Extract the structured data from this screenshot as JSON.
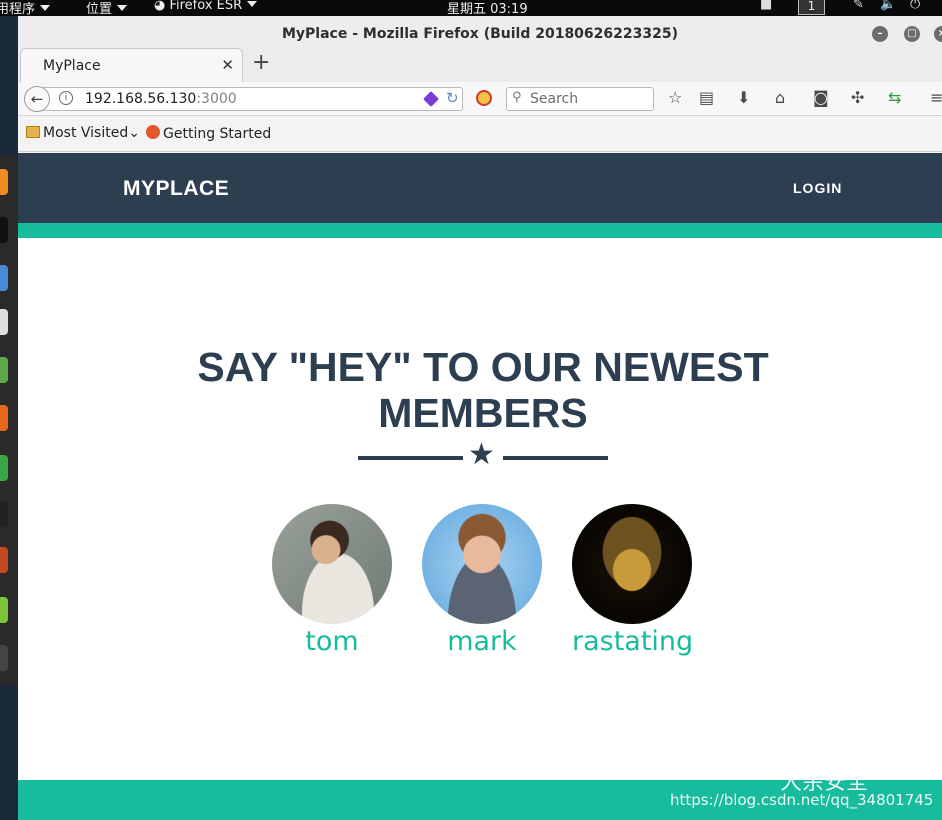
{
  "desktop": {
    "applications_menu": "用程序",
    "places_menu": "位置",
    "active_app": "Firefox ESR",
    "clock": "星期五 03:19",
    "workspace": "1"
  },
  "window": {
    "title": "MyPlace - Mozilla Firefox (Build 20180626223325)"
  },
  "tab": {
    "title": "MyPlace"
  },
  "navbar": {
    "url_host": "192.168.56.130",
    "url_port": ":3000",
    "search_placeholder": "Search"
  },
  "bookmarks": [
    {
      "label": "Most Visited"
    },
    {
      "label": "Getting Started"
    }
  ],
  "site": {
    "brand": "MYPLACE",
    "login": "LOGIN",
    "heading_line1": "SAY \"HEY\" TO OUR NEWEST",
    "heading_line2": "MEMBERS",
    "members": [
      {
        "name": "tom"
      },
      {
        "name": "mark"
      },
      {
        "name": "rastating"
      }
    ],
    "accent_color": "#18bc9c",
    "primary_color": "#2c3e50"
  },
  "overlay": {
    "watermark_cn": "大余安全",
    "watermark_url": "https://blog.csdn.net/qq_34801745"
  }
}
